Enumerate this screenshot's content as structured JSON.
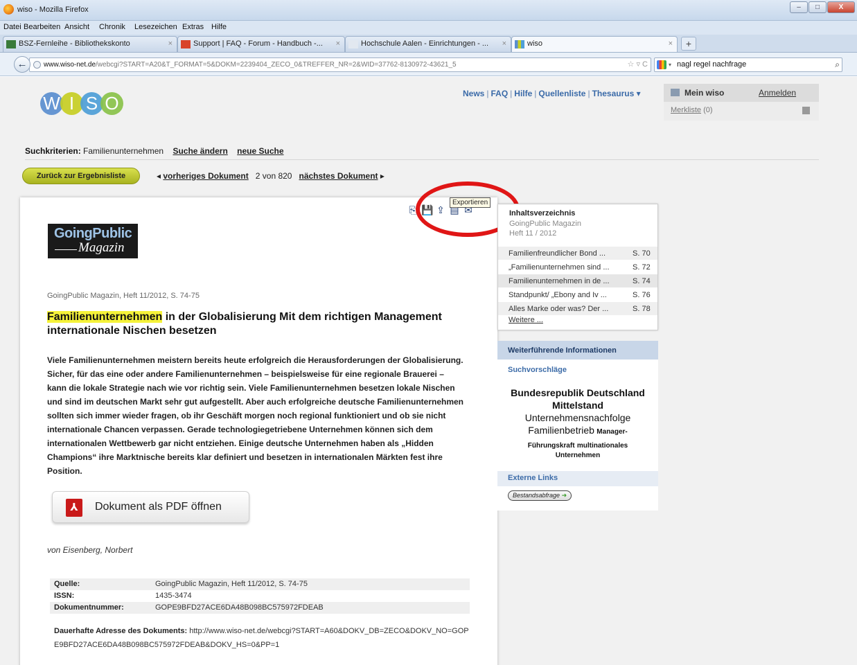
{
  "window": {
    "title": "wiso - Mozilla Firefox",
    "buttons": [
      "–",
      "□",
      "X"
    ]
  },
  "menu": [
    "Datei",
    "Bearbeiten",
    "Ansicht",
    "Chronik",
    "Lesezeichen",
    "Extras",
    "Hilfe"
  ],
  "tabs": [
    {
      "label": "BSZ-Fernleihe - Bibliothekskonto",
      "active": false
    },
    {
      "label": "Support | FAQ - Forum - Handbuch -...",
      "active": false
    },
    {
      "label": "Hochschule Aalen - Einrichtungen - ...",
      "active": false
    },
    {
      "label": "wiso",
      "active": true
    }
  ],
  "tab_close": "×",
  "newtab": "+",
  "nav": {
    "back": "←",
    "url_domain": "www.wiso-net.de",
    "url_path": "/webcgi?START=A20&T_FORMAT=5&DOKM=2239404_ZECO_0&TREFFER_NR=2&WID=37762-8130972-43621_5",
    "url_icons": "☆ ▿ C",
    "search_value": "nagl regel nachfrage",
    "search_dd": "▾",
    "search_icon": "⌕"
  },
  "logo": {
    "letters": [
      "W",
      "I",
      "S",
      "O"
    ],
    "colors": [
      "#5b8fd0",
      "#c7cf25",
      "#4f9fd8",
      "#8bc34a"
    ]
  },
  "topnav": {
    "items": [
      "News",
      "FAQ",
      "Hilfe",
      "Quellenliste",
      "Thesaurus ▾"
    ],
    "sep": "|"
  },
  "user": {
    "mein": "Mein wiso",
    "anmelden": "Anmelden",
    "merkliste": "Merkliste",
    "merk_count": "(0)"
  },
  "criteria": {
    "label": "Suchkriterien:",
    "value": "Familienunternehmen",
    "change": "Suche ändern",
    "new": "neue Suche"
  },
  "docnav": {
    "back_results": "Zurück zur Ergebnisliste",
    "prev": "vorheriges Dokument",
    "prev_arrow": "◂",
    "pos": "2 von 820",
    "next": "nächstes Dokument",
    "next_arrow": "▸"
  },
  "tooltip": "Exportieren",
  "toolicons": [
    "⎘",
    "💾",
    "⇪",
    "▤",
    "✉"
  ],
  "publisher_logo": {
    "line1": "GoingPublic",
    "line2": "Magazin"
  },
  "article": {
    "source_line": "GoingPublic Magazin, Heft 11/2012, S. 74-75",
    "title_highlight": "Familienunternehmen",
    "title_rest": " in der Globalisierung Mit dem richtigen Management internationale Nischen besetzen",
    "body": "Viele Familienunternehmen meistern bereits heute erfolgreich die Herausforderungen der Globalisierung. Sicher, für das eine oder andere Familienunternehmen – beispielsweise für eine regionale Brauerei – kann die lokale Strategie nach wie vor richtig sein. Viele Familienunternehmen besetzen lokale Nischen und sind im deutschen Markt sehr gut aufgestellt. Aber auch erfolgreiche deutsche Familienunternehmen sollten sich immer wieder fragen, ob ihr Geschäft morgen noch regional funktioniert und ob sie nicht internationale Chancen verpassen. Gerade technologiegetriebene Unternehmen können sich dem internationalen Wettbewerb gar nicht entziehen. Einige deutsche Unternehmen haben als „Hidden Champions“ ihre Marktnische bereits klar definiert und besetzen in internationalen Märkten fest ihre Position.",
    "pdf_button": "Dokument als PDF öffnen",
    "pdf_icon": "⅄",
    "author": "von Eisenberg, Norbert",
    "meta": [
      {
        "k": "Quelle:",
        "v": "GoingPublic Magazin, Heft 11/2012, S. 74-75"
      },
      {
        "k": "ISSN:",
        "v": "1435-3474"
      },
      {
        "k": "Dokumentnummer:",
        "v": "GOPE9BFD27ACE6DA48B098BC575972FDEAB"
      }
    ],
    "perm_label": "Dauerhafte Adresse des Dokuments:",
    "perm_url": "http://www.wiso-net.de/webcgi?START=A60&DOKV_DB=ZECO&DOKV_NO=GOPE9BFD27ACE6DA48B098BC575972FDEAB&DOKV_HS=0&PP=1"
  },
  "toc": {
    "title": "Inhaltsverzeichnis",
    "sub1": "GoingPublic Magazin",
    "sub2": "Heft 11 / 2012",
    "items": [
      {
        "t": "Familienfreundlicher Bond ...",
        "p": "S. 70"
      },
      {
        "t": "„Familienunternehmen sind ...",
        "p": "S. 72"
      },
      {
        "t": "Familienunternehmen in de ...",
        "p": "S. 74"
      },
      {
        "t": "Standpunkt/ „Ebony and Iv ...",
        "p": "S. 76"
      },
      {
        "t": "Alles Marke oder was? Der ...",
        "p": "S. 78"
      }
    ],
    "more": "Weitere ..."
  },
  "info": {
    "header": "Weiterführende Informationen",
    "suggest": "Suchvorschläge",
    "tags": [
      "Bundesrepublik Deutschland",
      "Mittelstand",
      "Unternehmensnachfolge",
      "Familienbetrieb",
      "Manager-",
      "Führungskraft",
      "multinationales",
      "Unternehmen"
    ],
    "external": "Externe Links",
    "bestand": "Bestandsabfrage",
    "bestand_arrow": "➜"
  }
}
